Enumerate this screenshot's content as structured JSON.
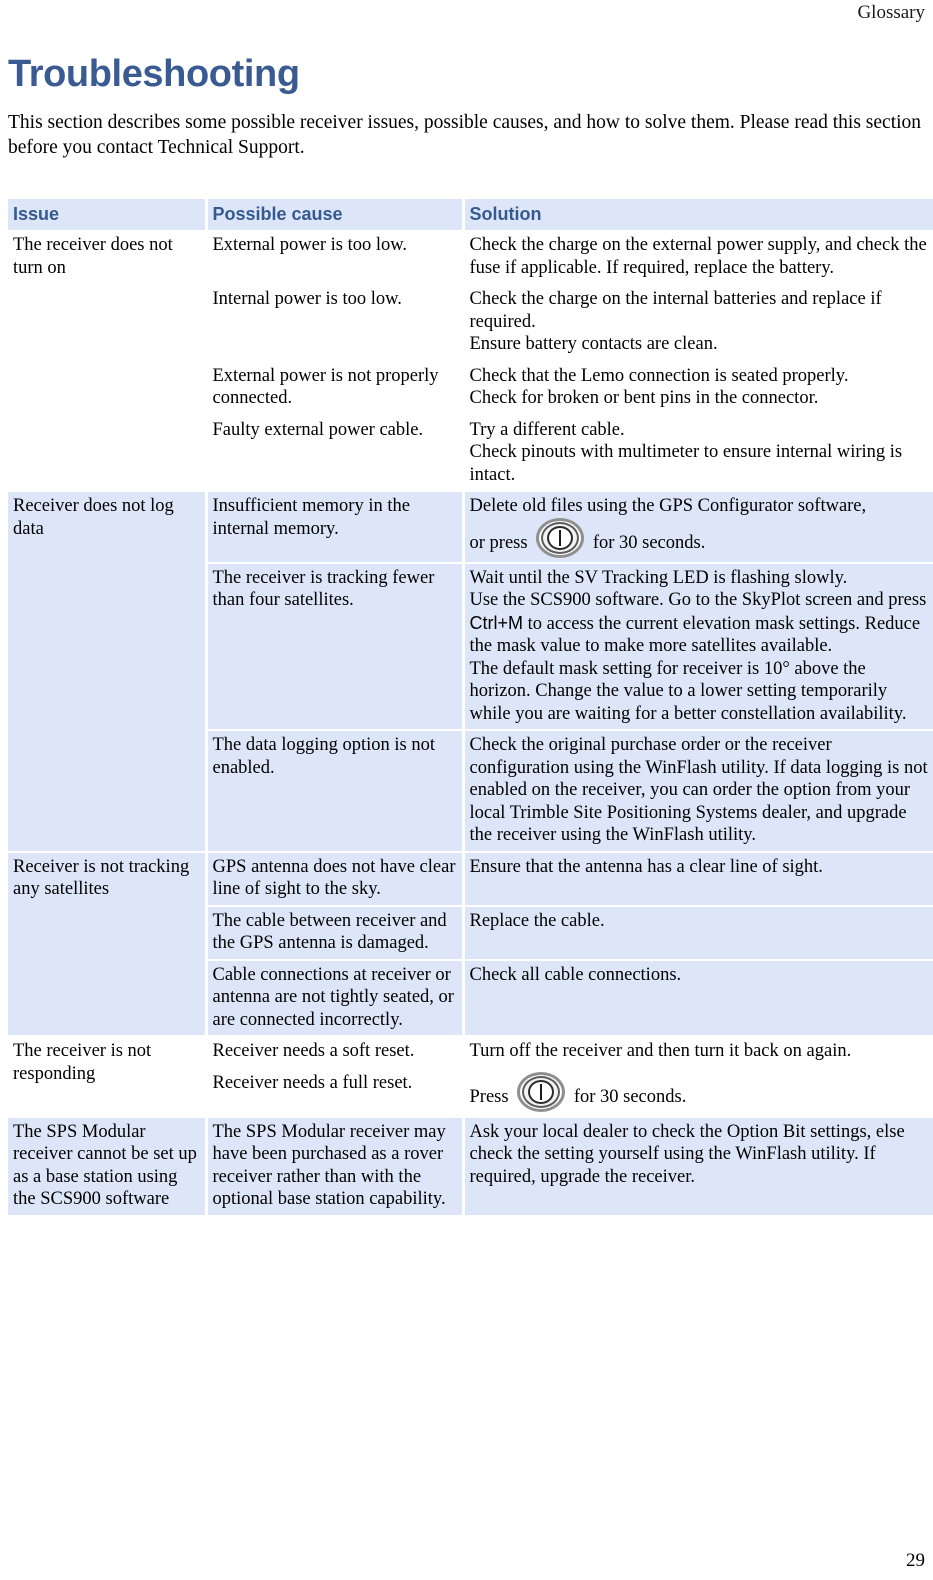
{
  "header": {
    "running_head": "Glossary"
  },
  "chapter": {
    "title": "Troubleshooting",
    "intro": "This section describes some possible receiver issues, possible causes, and how to solve them. Please read this section before you contact Technical Support."
  },
  "table": {
    "columns": [
      "Issue",
      "Possible cause",
      "Solution"
    ],
    "rows": [
      {
        "issue": "The receiver does not turn on",
        "shaded": false,
        "entries": [
          {
            "cause": "External power is too low.",
            "solution_lines": [
              "Check the charge on the external power supply, and check the fuse if applicable. If required, replace the battery."
            ]
          },
          {
            "cause": "Internal power is too low.",
            "solution_lines": [
              "Check the charge on the internal batteries and replace if required.",
              "Ensure battery contacts are clean."
            ]
          },
          {
            "cause": "External power is not properly connected.",
            "solution_lines": [
              "Check that the Lemo connection is seated properly.",
              "Check for broken or bent pins in the connector."
            ]
          },
          {
            "cause": "Faulty external power cable.",
            "solution_lines": [
              "Try a different cable.",
              "Check pinouts with multimeter to ensure internal wiring is intact."
            ]
          }
        ]
      },
      {
        "issue": "Receiver does not log data",
        "shaded": true,
        "entries": [
          {
            "cause": "Insufficient memory in the internal memory.",
            "solution_prefix": "Delete old files using the GPS Configurator software,",
            "solution_press_before": "or press",
            "solution_press_after": "for 30 seconds.",
            "icon": "power-button-icon"
          },
          {
            "cause": "The receiver is tracking fewer than four satellites.",
            "solution_lines": [
              "Wait until the SV Tracking LED is flashing slowly.",
              "Use the SCS900 software. Go to the SkyPlot screen and press |Ctrl+M| to access the current elevation mask settings. Reduce the mask value to make more satellites available.",
              "The default mask setting for receiver is 10° above the horizon. Change the value to a lower setting temporarily while you are waiting for a better constellation availability."
            ]
          },
          {
            "cause": "The data logging option is not enabled.",
            "solution_lines": [
              "Check the original purchase order or the receiver configuration using the WinFlash utility. If data logging is not enabled on the receiver, you can order the option from your local Trimble Site Positioning Systems dealer, and upgrade the receiver using the WinFlash utility."
            ]
          }
        ]
      },
      {
        "issue": "Receiver is not tracking any satellites",
        "shaded": true,
        "entries": [
          {
            "cause": "GPS antenna does not have clear line of sight to the sky.",
            "solution_lines": [
              "Ensure that the antenna has a clear line of sight."
            ]
          },
          {
            "cause": "The cable between receiver and the GPS antenna is damaged.",
            "solution_lines": [
              "Replace the cable."
            ]
          },
          {
            "cause": "Cable connections at receiver or antenna are not tightly seated, or are connected incorrectly.",
            "solution_lines": [
              "Check all cable connections."
            ]
          }
        ]
      },
      {
        "issue": "The receiver is not responding",
        "shaded": false,
        "entries": [
          {
            "cause": "Receiver needs a soft reset.",
            "solution_lines": [
              "Turn off the receiver and then turn it back on again."
            ]
          },
          {
            "cause": "Receiver needs a full reset.",
            "solution_press_before": "Press",
            "solution_press_after": "for 30 seconds.",
            "icon": "power-button-icon"
          }
        ]
      },
      {
        "issue": "The SPS Modular receiver cannot be set up as a base station using the SCS900 software",
        "shaded": true,
        "entries": [
          {
            "cause": "The SPS Modular receiver may have been purchased as a rover receiver rather than with the optional base station capability.",
            "solution_lines": [
              "Ask your local dealer to check the Option Bit settings, else check the setting yourself using the WinFlash utility. If required, upgrade the receiver."
            ]
          }
        ]
      }
    ]
  },
  "footer": {
    "page_number": "29"
  },
  "colors": {
    "header_band": "#dce6f8",
    "header_text": "#36598f",
    "title": "#3a5b92",
    "shaded_row": "#dce6f8",
    "body_text": "#000000"
  }
}
